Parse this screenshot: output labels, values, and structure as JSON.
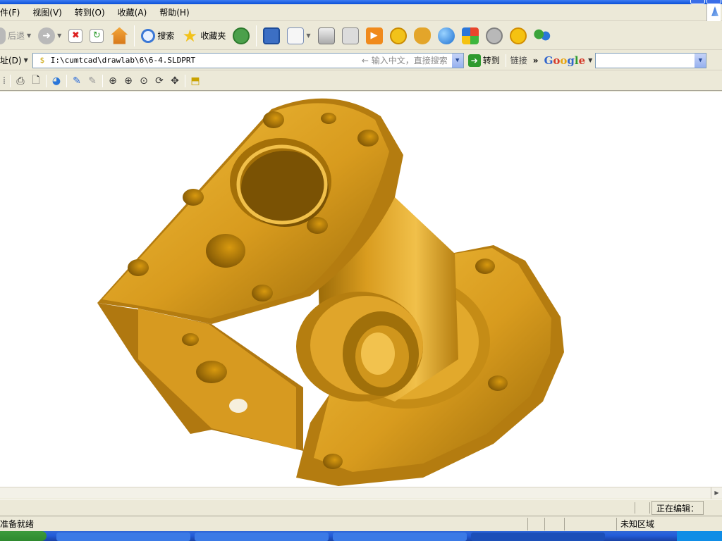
{
  "menu": {
    "items": [
      "件(F)",
      "视图(V)",
      "转到(O)",
      "收藏(A)",
      "帮助(H)"
    ]
  },
  "toolbar": {
    "back_label": "后退",
    "search_label": "搜索",
    "favorites_label": "收藏夹"
  },
  "address": {
    "label": "址(D)",
    "url": "I:\\cumtcad\\drawlab\\6\\6-4.SLDPRT",
    "hint": "← 输入中文，直接搜索",
    "go_label": "转到",
    "links_label": "链接",
    "more": "»",
    "google": [
      "G",
      "o",
      "o",
      "g",
      "l",
      "e"
    ]
  },
  "status": {
    "editing": "正在编辑：",
    "ready": "准备就绪",
    "zone": "未知区域"
  },
  "colors": {
    "part_base": "#d89b1e",
    "part_light": "#f0bd3c",
    "part_dark": "#9a6a08",
    "hole": "#7a5204"
  },
  "icons": {
    "stop": "stop-icon",
    "refresh": "refresh-icon",
    "home": "home-icon",
    "search": "magnifier-icon",
    "favorites": "star-icon",
    "history": "history-icon",
    "mail": "mail-icon",
    "print": "printer-icon"
  }
}
